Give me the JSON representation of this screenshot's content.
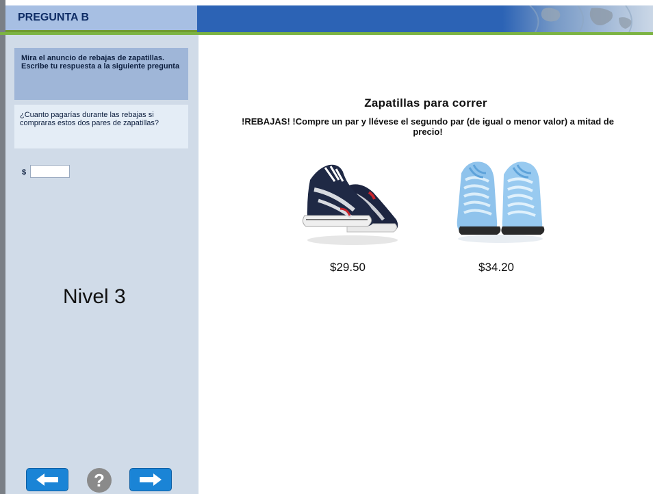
{
  "header": {
    "title": "PREGUNTA B"
  },
  "sidebar": {
    "instruction": "Mira el anuncio de rebajas de zapatillas. Escribe tu respuesta a la siguiente pregunta",
    "question": "¿Cuanto pagarías durante las rebajas si compraras estos dos pares de zapatillas?",
    "currency_symbol": "$",
    "answer_value": "",
    "level": "Nivel 3"
  },
  "nav": {
    "help_label": "?",
    "prev_icon": "arrow-left-icon",
    "next_icon": "arrow-right-icon"
  },
  "ad": {
    "title": "Zapatillas  para correr",
    "subtitle": "!REBAJAS! !Compre un par y llévese el segundo par (de igual o menor valor) a mitad de precio!",
    "products": [
      {
        "price": "$29.50"
      },
      {
        "price": "$34.20"
      }
    ]
  },
  "colors": {
    "header_blue": "#2c63b5",
    "title_box": "#a7bfe3",
    "accent_green": "#7cb342",
    "sidebar_bg": "#d0dbe8",
    "nav_button": "#1a84d6"
  }
}
